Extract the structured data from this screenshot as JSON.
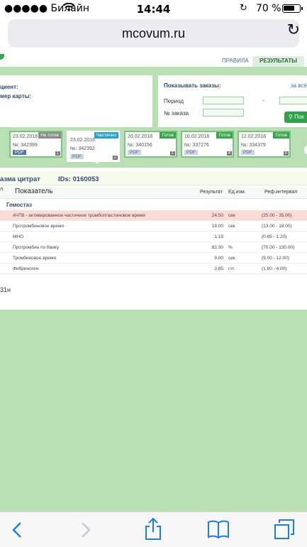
{
  "status_bar": {
    "carrier": "●●●●● Билайн",
    "time": "14:44",
    "battery": "70 %",
    "battery_level": 0.7
  },
  "browser": {
    "url": "mcovum.ru"
  },
  "nav_tabs": {
    "rules": "ПРАВИЛА",
    "results": "РЕЗУЛЬТАТЫ"
  },
  "patient_panel": {
    "patient_label": "циент:",
    "card_label": "мер карты:"
  },
  "orders_filter": {
    "title": "Показывать заказы:",
    "all_link": "за всё",
    "period_label": "Период",
    "dash": "-",
    "order_no_label": "№ заказа",
    "show_button": "Пок"
  },
  "orders": [
    {
      "date": "23.02.2018",
      "number": "№: 342399",
      "status": "Не готов",
      "status_color": "#8a8a8a",
      "pdf": "PDF",
      "index": "1"
    },
    {
      "date": "23.02.2018",
      "number": "№: 342392",
      "status": "Частично",
      "status_color": "#2aa3c9",
      "pdf": "PDF",
      "index": "2"
    },
    {
      "date": "20.02.2018",
      "number": "№: 340156",
      "status": "Готов",
      "status_color": "#37a84a",
      "pdf": "PDF",
      "index": "1"
    },
    {
      "date": "16.02.2018",
      "number": "№: 337276",
      "status": "Готов",
      "status_color": "#37a84a",
      "pdf": "PDF",
      "index": "4"
    },
    {
      "date": "12.02.2018",
      "number": "№: 334379",
      "status": "Готов",
      "status_color": "#37a84a",
      "pdf": "PDF",
      "index": "5"
    }
  ],
  "result": {
    "sample": "азма цитрат",
    "ids": "IDs: 0160053",
    "col_left": "л.",
    "columns": {
      "indicator": "Показатель",
      "result": "Результат",
      "unit": "Ед.изм.",
      "ref": "Реф.интервал"
    },
    "section": "Гемостаз",
    "rows": [
      {
        "name": "АЧТВ - активированное частичное тромбопластиновое время",
        "value": "24.50",
        "unit": "сек",
        "ref": "(25.00 - 35.00)",
        "flag": true
      },
      {
        "name": "Протромбиновое время",
        "value": "18.00",
        "unit": "сек",
        "ref": "(13.00 - 18.00)",
        "flag": false
      },
      {
        "name": "МНО",
        "value": "1.19",
        "unit": "",
        "ref": "(0.85 - 1.20)",
        "flag": false
      },
      {
        "name": "Протромбин по Квику",
        "value": "82.30",
        "unit": "%",
        "ref": "(70.00 - 130.00)",
        "flag": false
      },
      {
        "name": "Тромбиновое время",
        "value": "9.00",
        "unit": "сек",
        "ref": "(9.00 - 12.00)",
        "flag": false
      },
      {
        "name": "Фибриноген",
        "value": "3.85",
        "unit": "г/л",
        "ref": "(1.80 - 4.00)",
        "flag": false
      }
    ],
    "footer": "31н"
  }
}
